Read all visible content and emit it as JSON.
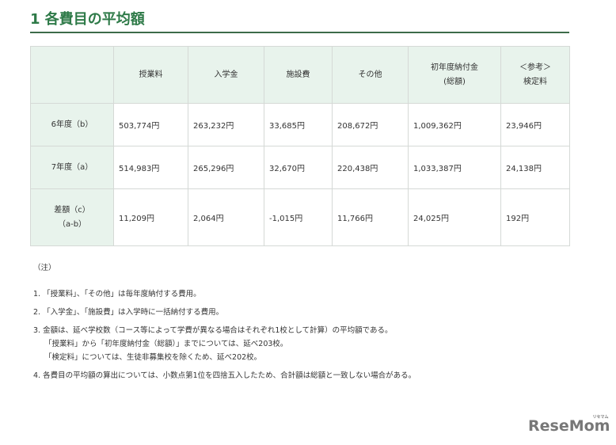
{
  "title": "1 各費目の平均額",
  "headers": [
    "",
    "授業料",
    "入学金",
    "施設費",
    "その他",
    "初年度納付金\n(総額)",
    "＜参考＞\n検定料"
  ],
  "rows": [
    {
      "label": "6年度（b）",
      "values": [
        "503,774円",
        "263,232円",
        "33,685円",
        "208,672円",
        "1,009,362円",
        "23,946円"
      ]
    },
    {
      "label": "7年度（a）",
      "values": [
        "514,983円",
        "265,296円",
        "32,670円",
        "220,438円",
        "1,033,387円",
        "24,138円"
      ]
    },
    {
      "label": "差額（c）\n（a-b）",
      "values": [
        "11,209円",
        "2,064円",
        "-1,015円",
        "11,766円",
        "24,025円",
        "192円"
      ]
    }
  ],
  "notes": {
    "heading": "（注）",
    "items": [
      "1. 「授業料」、「その他」は毎年度納付する費用。",
      "2. 「入学金」、「施設費」は入学時に一括納付する費用。",
      "3. 金額は、延べ学校数（コース等によって学費が異なる場合はそれぞれ1校として計算）の平均額である。",
      "「授業料」から「初年度納付金（総額）」までについては、延べ203校。",
      "「検定料」については、生徒非募集校を除くため、延べ202校。",
      "4. 各費目の平均額の算出については、小数点第1位を四捨五入したため、合計額は総額と一致しない場合がある。"
    ]
  },
  "logo": {
    "text": "ReseMom",
    "sub": "リセマム"
  }
}
